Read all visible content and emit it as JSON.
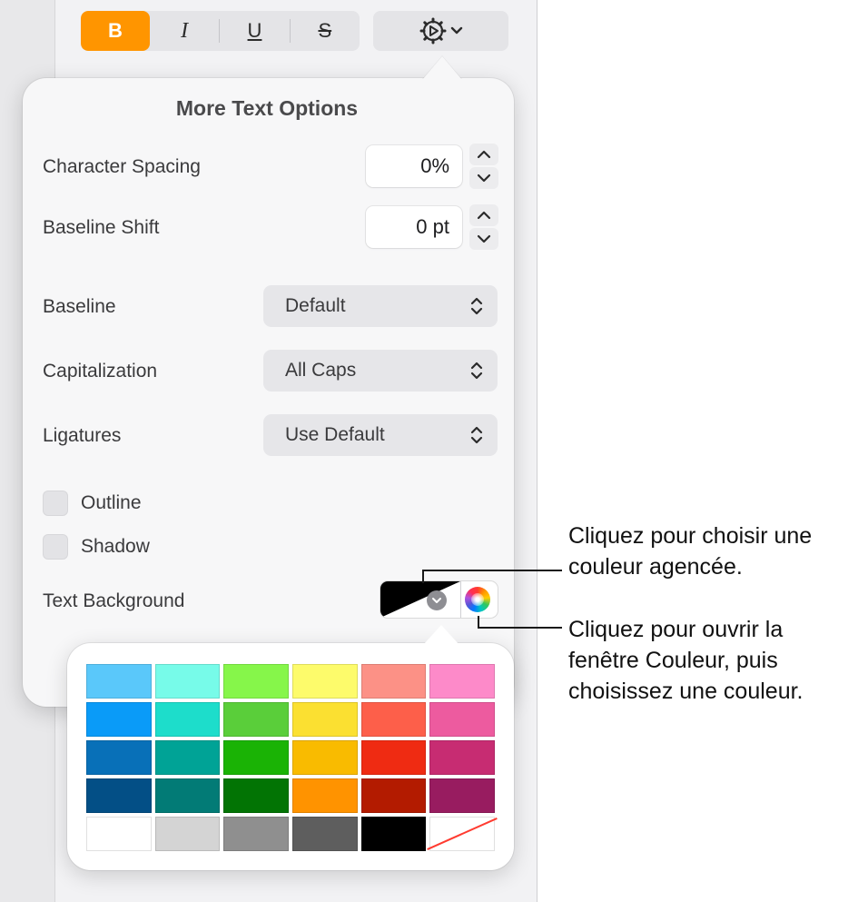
{
  "toolbar": {
    "bold_label": "B",
    "italic_label": "I",
    "underline_label": "U",
    "strikethrough_label": "S",
    "gear_menu_icon": "gear-icon",
    "chevron_icon": "chevron-down-icon"
  },
  "popover": {
    "title": "More Text Options",
    "character_spacing": {
      "label": "Character Spacing",
      "value": "0%"
    },
    "baseline_shift": {
      "label": "Baseline Shift",
      "value": "0 pt"
    },
    "baseline": {
      "label": "Baseline",
      "selected": "Default"
    },
    "capitalization": {
      "label": "Capitalization",
      "selected": "All Caps"
    },
    "ligatures": {
      "label": "Ligatures",
      "selected": "Use Default"
    },
    "outline": {
      "label": "Outline",
      "checked": false
    },
    "shadow": {
      "label": "Shadow",
      "checked": false
    },
    "text_background": {
      "label": "Text Background"
    }
  },
  "palette": {
    "rows": [
      [
        "#5ac8fa",
        "#77fbe9",
        "#86f64a",
        "#fdfb6b",
        "#fc9186",
        "#fd8ac9"
      ],
      [
        "#0a9bf8",
        "#1dddcb",
        "#5ace3a",
        "#fbe031",
        "#fd5f4a",
        "#ed5b9f"
      ],
      [
        "#0870b8",
        "#00a396",
        "#1ab305",
        "#f9bb00",
        "#ef2b12",
        "#c72c72"
      ],
      [
        "#034f86",
        "#027b76",
        "#027404",
        "#ff9300",
        "#b31b00",
        "#981c60"
      ],
      [
        "#ffffff",
        "#d4d4d4",
        "#8f8f8f",
        "#5e5e5e",
        "#000000",
        "none"
      ]
    ]
  },
  "callouts": {
    "swatch_line1": "Cliquez pour choisir une",
    "swatch_line2": "couleur agencée.",
    "wheel_line1": "Cliquez pour ouvrir la",
    "wheel_line2": "fenêtre Couleur, puis",
    "wheel_line3": "choisissez une couleur."
  },
  "colors": {
    "accent": "#ff9500",
    "popover_bg": "#f7f7f8",
    "control_bg": "#e6e6e9"
  }
}
